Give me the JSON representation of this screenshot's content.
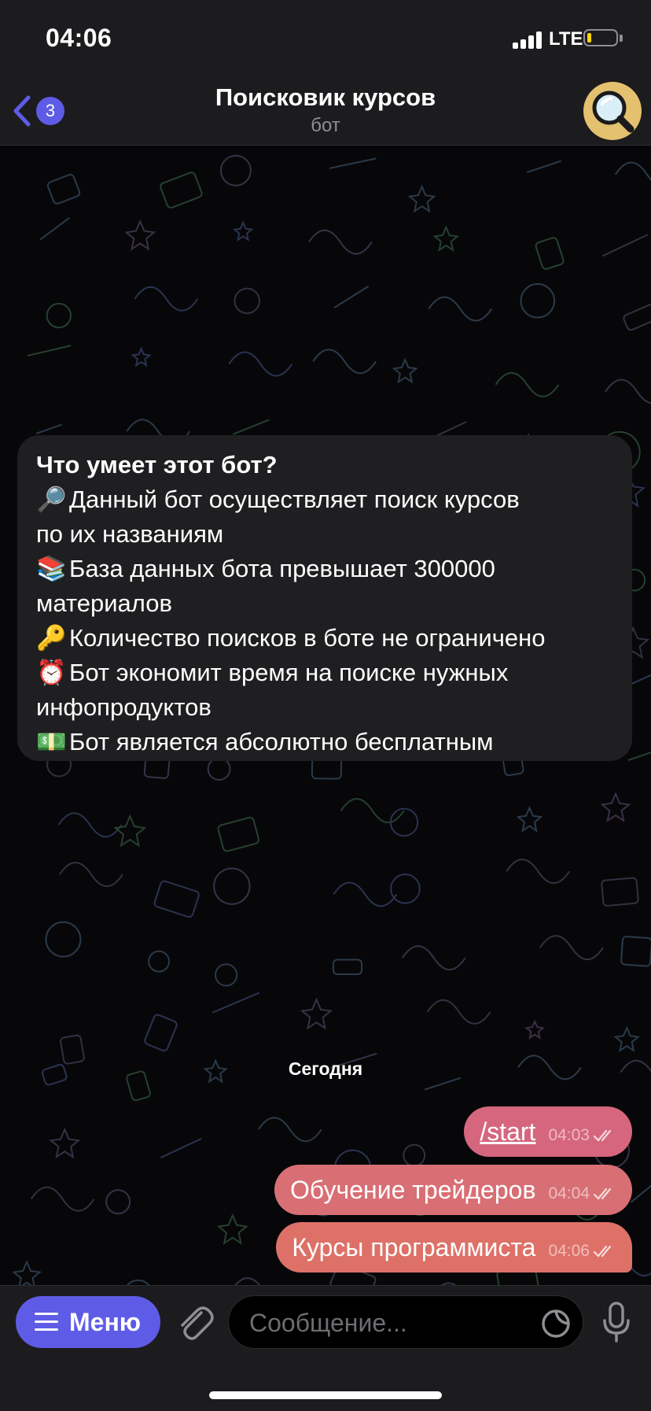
{
  "status_bar": {
    "time": "04:06",
    "network": "LTE",
    "battery_level": 0.15,
    "battery_color": "#ffd60a"
  },
  "header": {
    "back_badge": "3",
    "title": "Поисковик курсов",
    "subtitle": "бот",
    "avatar_icon": "magnifier-icon"
  },
  "info_card": {
    "title": "Что умеет этот бот?",
    "lines": [
      {
        "emoji": "🔎",
        "text": "Данный бот осуществляет поиск курсов",
        "cont": "по их названиям"
      },
      {
        "emoji": "📚",
        "text": "База данных бота превышает 300000",
        "cont": "материалов"
      },
      {
        "emoji": "🔑",
        "text": "Количество поисков в боте не ограничено",
        "cont": ""
      },
      {
        "emoji": "⏰",
        "text": "Бот экономит время на поиске нужных",
        "cont": "инфопродуктов"
      },
      {
        "emoji": "💵",
        "text": "Бот является абсолютно бесплатным",
        "cont": ""
      }
    ]
  },
  "date_separator": "Сегодня",
  "messages": [
    {
      "text": "/start",
      "time": "04:03",
      "color": "#d5667e"
    },
    {
      "text": "Обучение трейдеров",
      "time": "04:04",
      "color": "#d86f74"
    },
    {
      "text": "Курсы программиста",
      "time": "04:06",
      "color": "#dd7168"
    }
  ],
  "input_bar": {
    "menu_label": "Меню",
    "placeholder": "Сообщение..."
  },
  "colors": {
    "accent": "#5e5ce6",
    "bar_bg": "#1c1c1e",
    "bubble_in": "#1f1f21"
  }
}
